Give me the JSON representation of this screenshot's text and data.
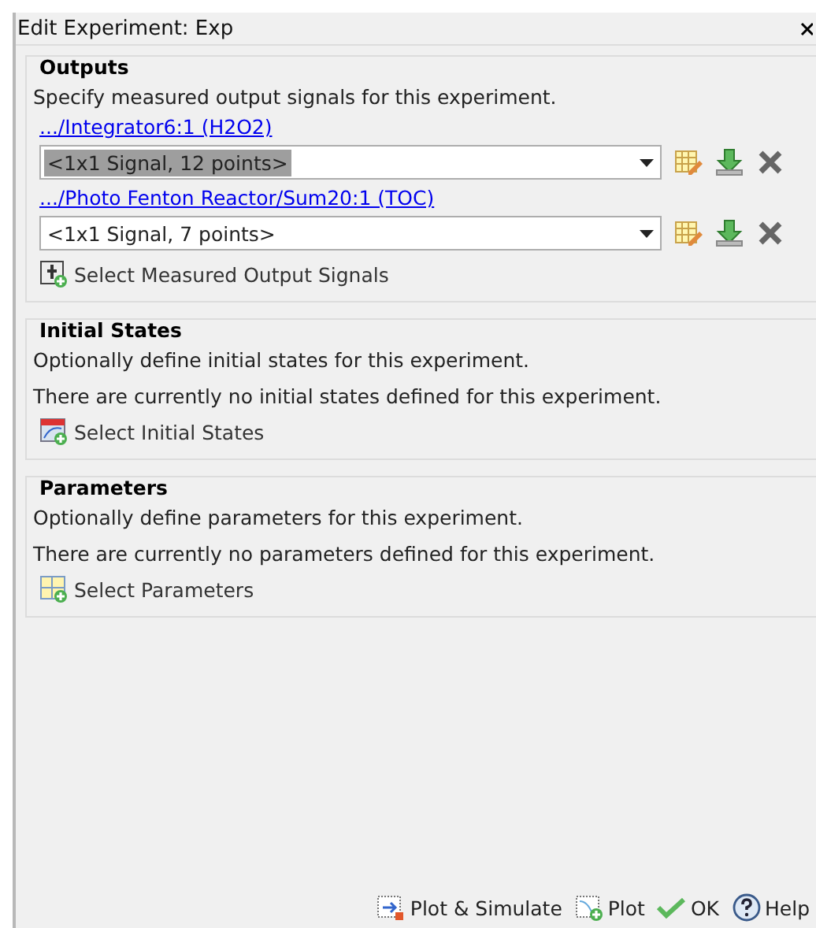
{
  "window": {
    "title": "Edit Experiment: Exp"
  },
  "outputs": {
    "title": "Outputs",
    "description": "Specify measured output signals for this experiment.",
    "signals": [
      {
        "link": ".../Integrator6:1 (H2O2)",
        "value": "<1x1 Signal, 12 points>",
        "text_selected": true
      },
      {
        "link": ".../Photo Fenton Reactor/Sum20:1 (TOC)",
        "value": "<1x1 Signal, 7 points>",
        "text_selected": false
      }
    ],
    "action": "Select Measured Output Signals"
  },
  "initial_states": {
    "title": "Initial States",
    "description": "Optionally define initial states for this experiment.",
    "status": "There are currently no initial states defined for this experiment.",
    "action": "Select Initial States"
  },
  "parameters": {
    "title": "Parameters",
    "description": "Optionally define parameters for this experiment.",
    "status": "There are currently no parameters defined for this experiment.",
    "action": "Select Parameters"
  },
  "buttons": [
    {
      "kind": "plot_simulate",
      "label": "Plot & Simulate"
    },
    {
      "kind": "plot",
      "label": "Plot"
    },
    {
      "kind": "ok",
      "label": "OK"
    },
    {
      "kind": "help",
      "label": "Help"
    }
  ]
}
